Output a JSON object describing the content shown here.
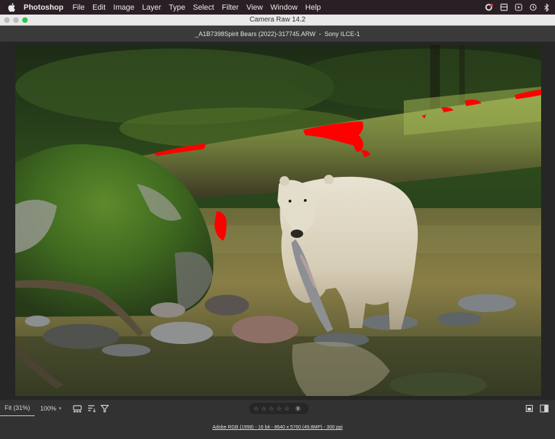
{
  "menubar": {
    "app_name": "Photoshop",
    "items": [
      "File",
      "Edit",
      "Image",
      "Layer",
      "Type",
      "Select",
      "Filter",
      "View",
      "Window",
      "Help"
    ]
  },
  "window": {
    "title": "Camera Raw 14.2"
  },
  "file_header": {
    "filename": "_A1B7398Spirit Bears (2022)-317745.ARW",
    "separator": "-",
    "camera": "Sony ILCE-1"
  },
  "toolbar": {
    "zoom_fit": "Fit (31%)",
    "zoom_100": "100%",
    "rating_stars": 5,
    "rating_value": 0
  },
  "status": {
    "info": "Adobe RGB (1998) - 16 bit - 8640 x 5760 (49.8MP) - 300 ppi"
  },
  "colors": {
    "clipping_warning": "#ff0000",
    "maximize": "#33c748"
  }
}
